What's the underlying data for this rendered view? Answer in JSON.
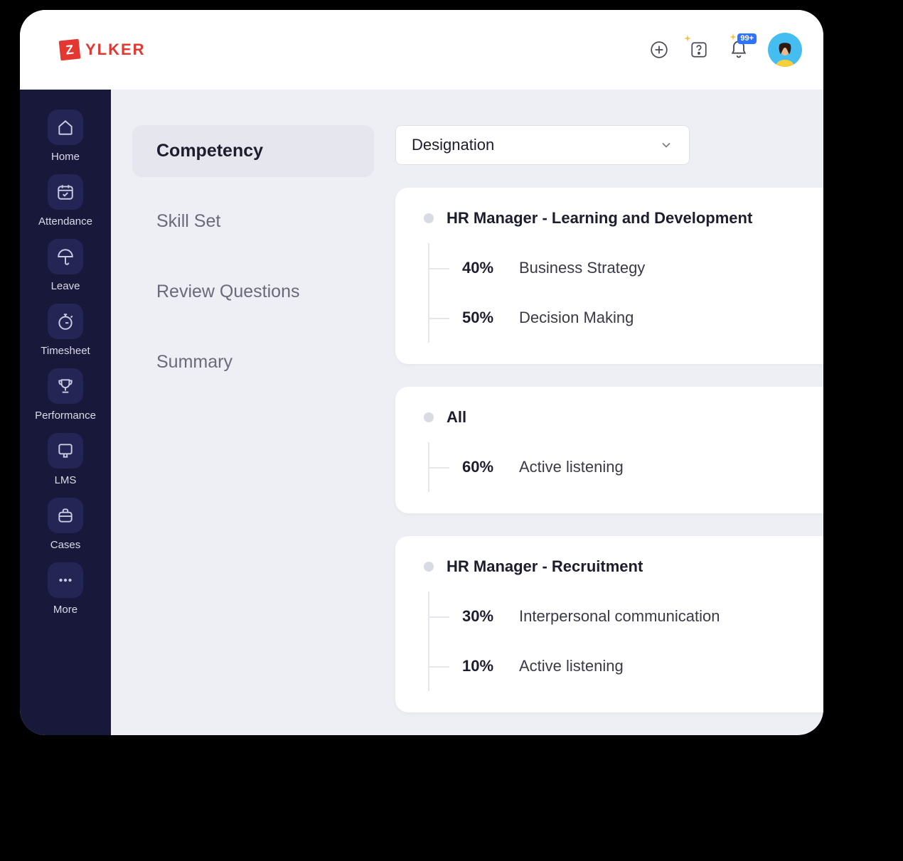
{
  "brand": {
    "badge_letter": "Z",
    "name": "YLKER"
  },
  "topbar": {
    "notification_badge": "99+"
  },
  "sidebar": {
    "items": [
      {
        "key": "home",
        "label": "Home"
      },
      {
        "key": "attendance",
        "label": "Attendance"
      },
      {
        "key": "leave",
        "label": "Leave"
      },
      {
        "key": "timesheet",
        "label": "Timesheet"
      },
      {
        "key": "performance",
        "label": "Performance"
      },
      {
        "key": "lms",
        "label": "LMS"
      },
      {
        "key": "cases",
        "label": "Cases"
      },
      {
        "key": "more",
        "label": "More"
      }
    ]
  },
  "subnav": {
    "items": [
      {
        "label": "Competency",
        "active": true
      },
      {
        "label": "Skill Set",
        "active": false
      },
      {
        "label": "Review Questions",
        "active": false
      },
      {
        "label": "Summary",
        "active": false
      }
    ]
  },
  "dropdown": {
    "selected": "Designation"
  },
  "groups": [
    {
      "title": "HR Manager - Learning and Development",
      "items": [
        {
          "pct": "40%",
          "label": "Business Strategy"
        },
        {
          "pct": "50%",
          "label": "Decision Making"
        }
      ]
    },
    {
      "title": "All",
      "items": [
        {
          "pct": "60%",
          "label": "Active listening"
        }
      ]
    },
    {
      "title": "HR Manager - Recruitment",
      "items": [
        {
          "pct": "30%",
          "label": "Interpersonal communication"
        },
        {
          "pct": "10%",
          "label": "Active listening"
        }
      ]
    }
  ]
}
